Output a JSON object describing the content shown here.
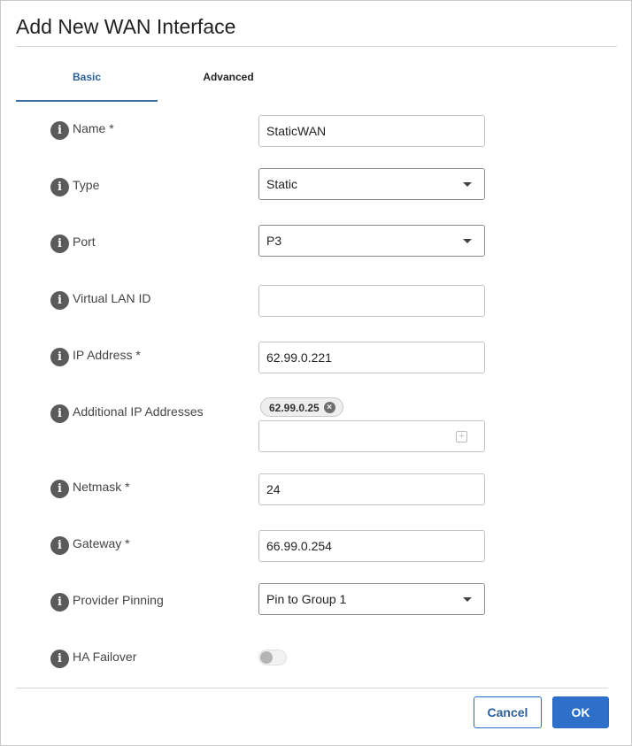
{
  "dialog": {
    "title": "Add New WAN Interface",
    "tabs": [
      {
        "label": "Basic",
        "active": true
      },
      {
        "label": "Advanced",
        "active": false
      }
    ],
    "fields": {
      "name": {
        "label": "Name *",
        "value": "StaticWAN"
      },
      "type": {
        "label": "Type",
        "value": "Static"
      },
      "port": {
        "label": "Port",
        "value": "P3"
      },
      "vlan": {
        "label": "Virtual LAN ID",
        "value": ""
      },
      "ip": {
        "label": "IP Address *",
        "value": "62.99.0.221"
      },
      "additional_ips": {
        "label": "Additional IP Addresses",
        "chips": [
          "62.99.0.25"
        ],
        "value": ""
      },
      "netmask": {
        "label": "Netmask *",
        "value": "24"
      },
      "gateway": {
        "label": "Gateway *",
        "value": "66.99.0.254"
      },
      "provider_pinning": {
        "label": "Provider Pinning",
        "value": "Pin to Group 1"
      },
      "ha_failover": {
        "label": "HA Failover",
        "enabled": false
      }
    },
    "buttons": {
      "cancel": "Cancel",
      "ok": "OK"
    },
    "info_glyph": "i",
    "icons": {
      "info": "info-icon",
      "dropdown": "chevron-down-icon",
      "remove": "close-icon",
      "add": "plus-icon"
    },
    "colors": {
      "accent": "#2e6fca",
      "tab_active": "#2b5f96"
    }
  }
}
